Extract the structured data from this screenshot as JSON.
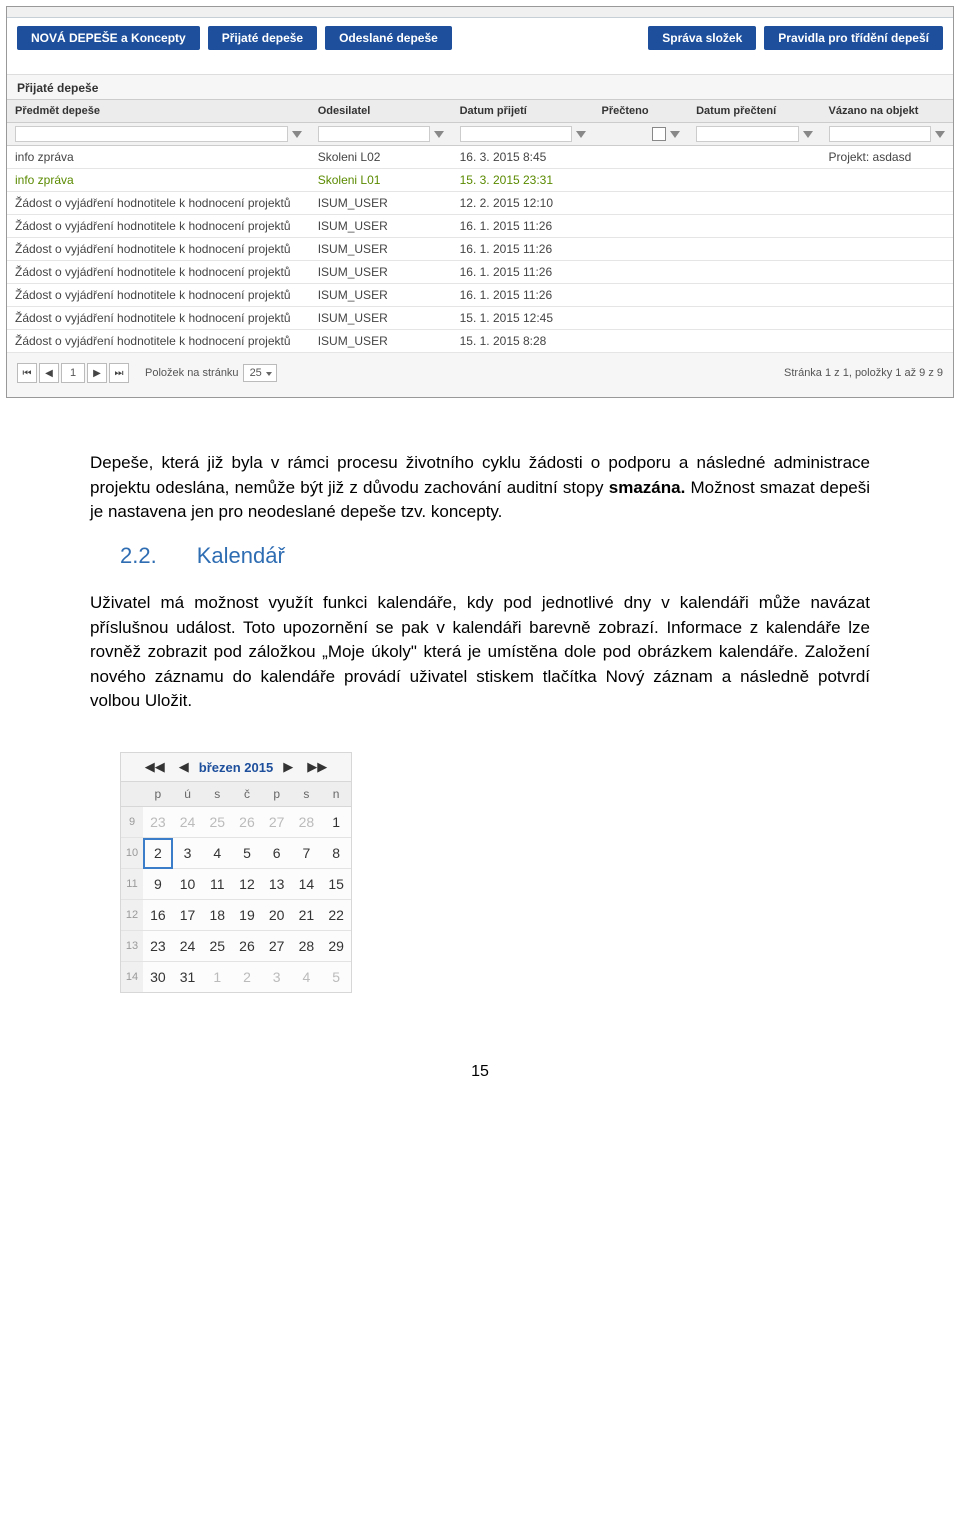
{
  "toolbar": {
    "new": "NOVÁ DEPEŠE a Koncepty",
    "received": "Přijaté depeše",
    "sent": "Odeslané depeše",
    "folders": "Správa složek",
    "rules": "Pravidla pro třídění depeší"
  },
  "panel_title": "Přijaté depeše",
  "columns": {
    "subject": "Předmět depeše",
    "sender": "Odesilatel",
    "received": "Datum přijetí",
    "read": "Přečteno",
    "read_date": "Datum přečtení",
    "bound": "Vázano na objekt"
  },
  "rows": [
    {
      "subject": "info zpráva",
      "sender": "Skoleni L02",
      "received": "16. 3. 2015 8:45",
      "read": "",
      "read_date": "",
      "bound": "Projekt: asdasd",
      "green": false
    },
    {
      "subject": "info zpráva",
      "sender": "Skoleni L01",
      "received": "15. 3. 2015 23:31",
      "read": "",
      "read_date": "",
      "bound": "",
      "green": true
    },
    {
      "subject": "Žádost o vyjádření hodnotitele k hodnocení projektů",
      "sender": "ISUM_USER",
      "received": "12. 2. 2015 12:10",
      "read": "",
      "read_date": "",
      "bound": "",
      "green": false
    },
    {
      "subject": "Žádost o vyjádření hodnotitele k hodnocení projektů",
      "sender": "ISUM_USER",
      "received": "16. 1. 2015 11:26",
      "read": "",
      "read_date": "",
      "bound": "",
      "green": false
    },
    {
      "subject": "Žádost o vyjádření hodnotitele k hodnocení projektů",
      "sender": "ISUM_USER",
      "received": "16. 1. 2015 11:26",
      "read": "",
      "read_date": "",
      "bound": "",
      "green": false
    },
    {
      "subject": "Žádost o vyjádření hodnotitele k hodnocení projektů",
      "sender": "ISUM_USER",
      "received": "16. 1. 2015 11:26",
      "read": "",
      "read_date": "",
      "bound": "",
      "green": false
    },
    {
      "subject": "Žádost o vyjádření hodnotitele k hodnocení projektů",
      "sender": "ISUM_USER",
      "received": "16. 1. 2015 11:26",
      "read": "",
      "read_date": "",
      "bound": "",
      "green": false
    },
    {
      "subject": "Žádost o vyjádření hodnotitele k hodnocení projektů",
      "sender": "ISUM_USER",
      "received": "15. 1. 2015 12:45",
      "read": "",
      "read_date": "",
      "bound": "",
      "green": false
    },
    {
      "subject": "Žádost o vyjádření hodnotitele k hodnocení projektů",
      "sender": "ISUM_USER",
      "received": "15. 1. 2015 8:28",
      "read": "",
      "read_date": "",
      "bound": "",
      "green": false
    }
  ],
  "pager": {
    "page": "1",
    "per_page_label": "Položek na stránku",
    "per_page": "25",
    "summary": "Stránka 1 z 1, položky 1 až 9 z 9"
  },
  "body": {
    "p1a": "Depeše, která již byla v rámci procesu životního cyklu žádosti o podporu a následné administrace projektu odeslána, nemůže být již z důvodu zachování auditní stopy ",
    "p1b": "smazána.",
    "p1c": " Možnost smazat depeši je nastavena jen pro neodeslané depeše tzv. koncepty.",
    "hnum": "2.2.",
    "htxt": "Kalendář",
    "p2": "Uživatel má možnost využít funkci kalendáře, kdy pod jednotlivé dny v kalendáři může navázat příslušnou událost. Toto upozornění se pak v kalendáři barevně zobrazí. Informace z kalendáře lze rovněž zobrazit pod záložkou „Moje úkoly\" která je umístěna dole pod obrázkem kalendáře. Založení nového záznamu do kalendáře provádí uživatel stiskem tlačítka Nový záznam a následně potvrdí volbou Uložit."
  },
  "calendar": {
    "title": "březen 2015",
    "dow": [
      "p",
      "ú",
      "s",
      "č",
      "p",
      "s",
      "n"
    ],
    "weeks": [
      {
        "wk": "9",
        "d": [
          "23",
          "24",
          "25",
          "26",
          "27",
          "28",
          "1"
        ],
        "off": [
          0,
          1,
          2,
          3,
          4,
          5
        ],
        "today": -1
      },
      {
        "wk": "10",
        "d": [
          "2",
          "3",
          "4",
          "5",
          "6",
          "7",
          "8"
        ],
        "off": [],
        "today": 0
      },
      {
        "wk": "11",
        "d": [
          "9",
          "10",
          "11",
          "12",
          "13",
          "14",
          "15"
        ],
        "off": [],
        "today": -1
      },
      {
        "wk": "12",
        "d": [
          "16",
          "17",
          "18",
          "19",
          "20",
          "21",
          "22"
        ],
        "off": [],
        "today": -1
      },
      {
        "wk": "13",
        "d": [
          "23",
          "24",
          "25",
          "26",
          "27",
          "28",
          "29"
        ],
        "off": [],
        "today": -1
      },
      {
        "wk": "14",
        "d": [
          "30",
          "31",
          "1",
          "2",
          "3",
          "4",
          "5"
        ],
        "off": [
          2,
          3,
          4,
          5,
          6
        ],
        "today": -1
      }
    ]
  },
  "page_number": "15"
}
